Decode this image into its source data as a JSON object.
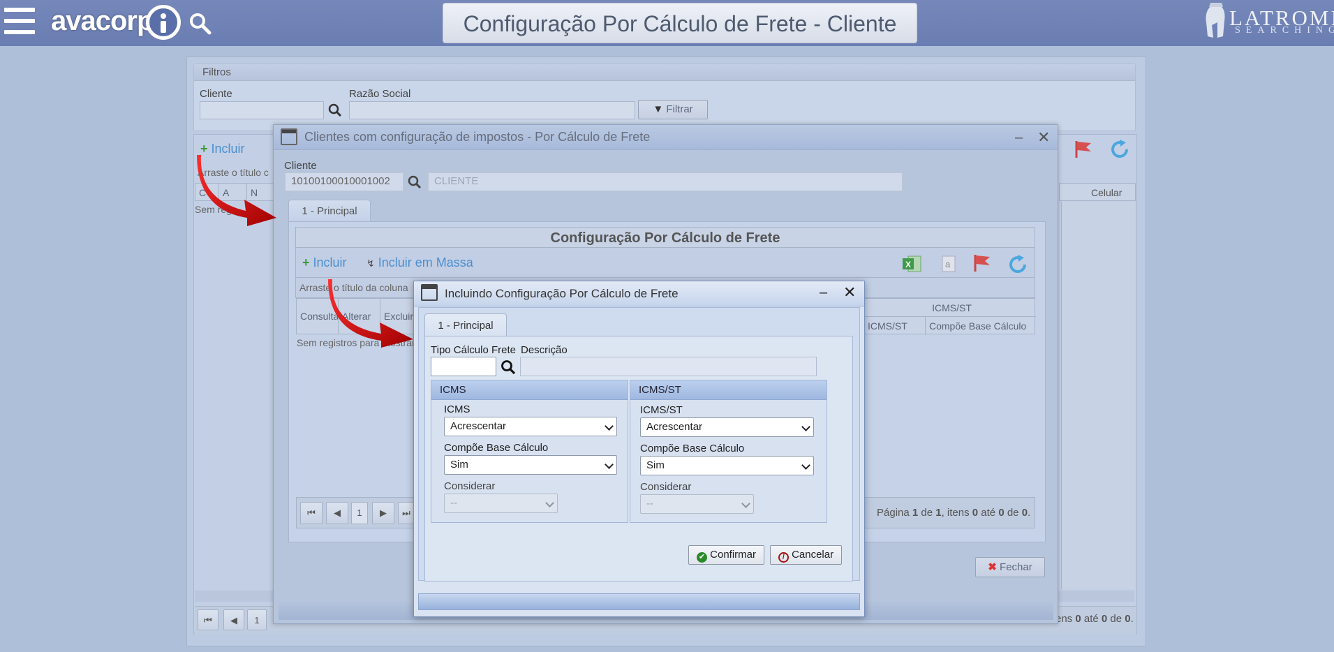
{
  "header": {
    "logo_text": "avacorp",
    "page_title": "Configuração Por Cálculo de Frete - Cliente",
    "brand_top": "LATROMI",
    "brand_bottom": "SEARCHING"
  },
  "filters": {
    "title": "Filtros",
    "cliente_label": "Cliente",
    "razao_label": "Razão Social",
    "filter_button": "Filtrar"
  },
  "main_grid": {
    "include_label": "Incluir",
    "group_hint": "Arraste o título c",
    "col_celular": "Celular",
    "col_short1": "C",
    "col_short2": "A",
    "col_short3": "N",
    "no_records": "Sem reg",
    "page": "1",
    "footer_text_a": "ens ",
    "footer_n1": "0",
    "footer_text_b": " até ",
    "footer_n2": "0",
    "footer_text_c": " de ",
    "footer_n3": "0",
    "footer_text_d": "."
  },
  "modal1": {
    "title": "Clientes com configuração de impostos - Por Cálculo de Frete",
    "cliente_label": "Cliente",
    "cliente_value": "10100100010001002",
    "cliente_name": "CLIENTE",
    "tab_principal": "1 - Principal",
    "grid_title": "Configuração Por Cálculo de Frete",
    "include_label": "Incluir",
    "include_mass_label": "Incluir em Massa",
    "group_hint": "Arraste o título da coluna",
    "columns": [
      "Consultar",
      "Alterar",
      "Excluir"
    ],
    "icmsst_group": "ICMS/ST",
    "col_icmsst": "ICMS/ST",
    "col_compoe": "Compõe Base Cálculo",
    "no_records": "Sem registros para mostrar",
    "page": "1",
    "pager_text_a": "Página ",
    "pager_page": "1",
    "pager_text_b": " de ",
    "pager_total": "1",
    "pager_text_c": ", itens ",
    "pager_from": "0",
    "pager_text_d": " até ",
    "pager_to": "0",
    "pager_text_e": " de ",
    "pager_count": "0",
    "pager_text_f": ".",
    "close_button": "Fechar"
  },
  "modal2": {
    "title": "Incluindo Configuração Por Cálculo de Frete",
    "tab_principal": "1 - Principal",
    "tipo_label": "Tipo Cálculo Frete",
    "descricao_label": "Descrição",
    "tipo_value": "",
    "descricao_value": "",
    "icms": {
      "group_title": "ICMS",
      "field_label": "ICMS",
      "field_value": "Acrescentar",
      "compoe_label": "Compõe Base Cálculo",
      "compoe_value": "Sim",
      "considerar_label": "Considerar",
      "considerar_value": "--"
    },
    "icmsst": {
      "group_title": "ICMS/ST",
      "field_label": "ICMS/ST",
      "field_value": "Acrescentar",
      "compoe_label": "Compõe Base Cálculo",
      "compoe_value": "Sim",
      "considerar_label": "Considerar",
      "considerar_value": "--"
    },
    "confirm_button": "Confirmar",
    "cancel_button": "Cancelar"
  },
  "colors": {
    "topbar": "#6f82b6",
    "accent_green": "#3a9a3a",
    "accent_red": "#d22",
    "refresh_blue": "#2aa0dd"
  }
}
